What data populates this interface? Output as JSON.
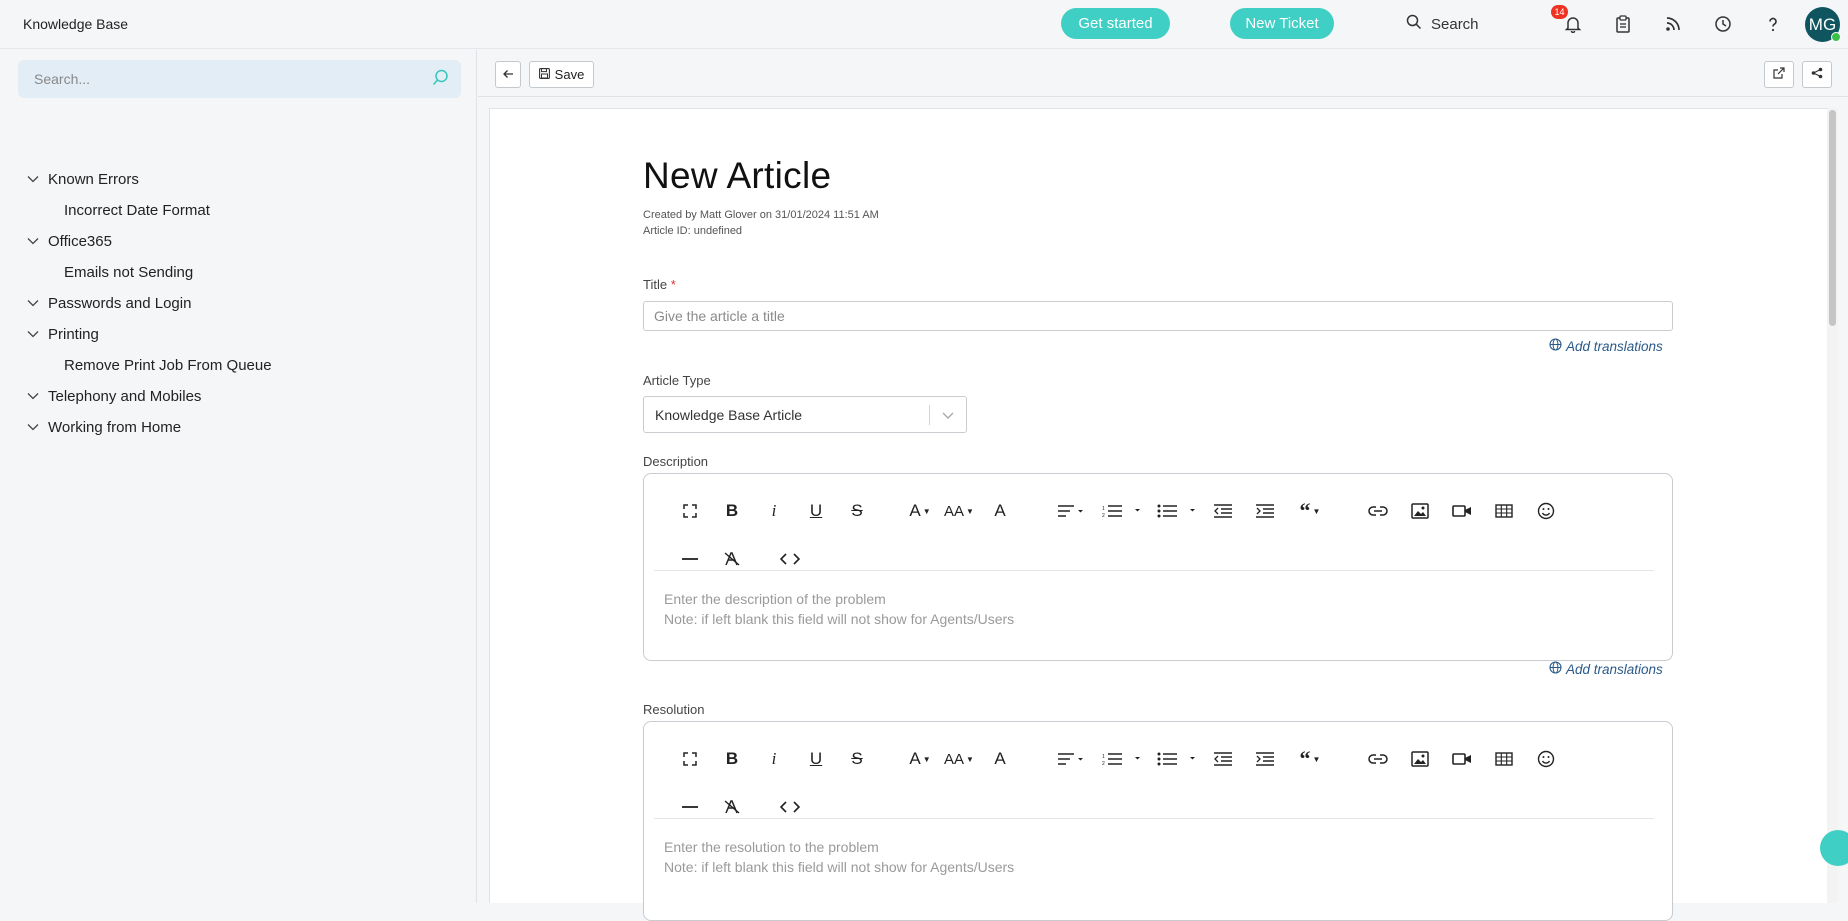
{
  "header": {
    "app_title": "Knowledge Base",
    "get_started_label": "Get started",
    "new_ticket_label": "New Ticket",
    "search_label": "Search",
    "notification_count": "14",
    "avatar_initials": "MG",
    "accent_color": "#3fcfc4"
  },
  "sidebar": {
    "search_placeholder": "Search...",
    "tree": [
      {
        "label": "Known Errors",
        "level": 0
      },
      {
        "label": "Incorrect Date Format",
        "level": 1
      },
      {
        "label": "Office365",
        "level": 0
      },
      {
        "label": "Emails not Sending",
        "level": 1
      },
      {
        "label": "Passwords and Login",
        "level": 0
      },
      {
        "label": "Printing",
        "level": 0
      },
      {
        "label": "Remove Print Job From Queue",
        "level": 1
      },
      {
        "label": "Telephony and Mobiles",
        "level": 0
      },
      {
        "label": "Working from Home",
        "level": 0
      }
    ]
  },
  "toolbar": {
    "save_label": "Save"
  },
  "article": {
    "heading": "New Article",
    "created_by": "Created by Matt Glover on 31/01/2024 11:51 AM",
    "article_id": "Article ID: undefined",
    "title_label": "Title",
    "title_required_mark": "*",
    "title_placeholder": "Give the article a title",
    "add_translations_label": "Add translations",
    "article_type_label": "Article Type",
    "article_type_value": "Knowledge Base Article",
    "description_label": "Description",
    "description_placeholder_line1": "Enter the description of the problem",
    "description_placeholder_line2": "Note: if left blank this field will not show for Agents/Users",
    "resolution_label": "Resolution",
    "resolution_placeholder_line1": "Enter the resolution to the problem",
    "resolution_placeholder_line2": "Note: if left blank this field will not show for Agents/Users"
  }
}
